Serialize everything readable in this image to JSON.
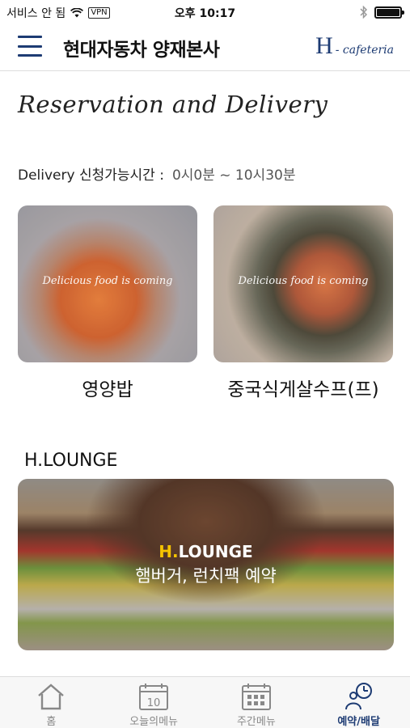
{
  "status_bar": {
    "carrier": "서비스 안 됨",
    "vpn": "VPN",
    "time": "오후 10:17"
  },
  "header": {
    "title": "현대자동차 양재본사",
    "brand_h": "H",
    "brand_sub": "- cafeteria"
  },
  "section_title": "Reservation and Delivery",
  "delivery": {
    "label": "Delivery 신청가능시간 :",
    "value": "0시0분 ~ 10시30분"
  },
  "menus": [
    {
      "overlay": "Delicious food is coming",
      "name": "영양밥"
    },
    {
      "overlay": "Delicious food is coming",
      "name": "중국식게살수프(프)"
    }
  ],
  "lounge": {
    "heading": "H.LOUNGE",
    "banner_h": "H.",
    "banner_brand_rest": "LOUNGE",
    "banner_tagline": "햄버거, 런치팩 예약"
  },
  "tabs": [
    {
      "label": "홈",
      "icon": "home-icon",
      "active": false
    },
    {
      "label": "오늘의메뉴",
      "icon": "calendar-day-icon",
      "calendar_day": "10",
      "active": false
    },
    {
      "label": "주간메뉴",
      "icon": "calendar-week-icon",
      "active": false
    },
    {
      "label": "예약/배달",
      "icon": "clock-person-icon",
      "active": true
    }
  ],
  "colors": {
    "accent": "#1d3b73",
    "lounge_h": "#f6c400",
    "tab_inactive": "#888888"
  }
}
